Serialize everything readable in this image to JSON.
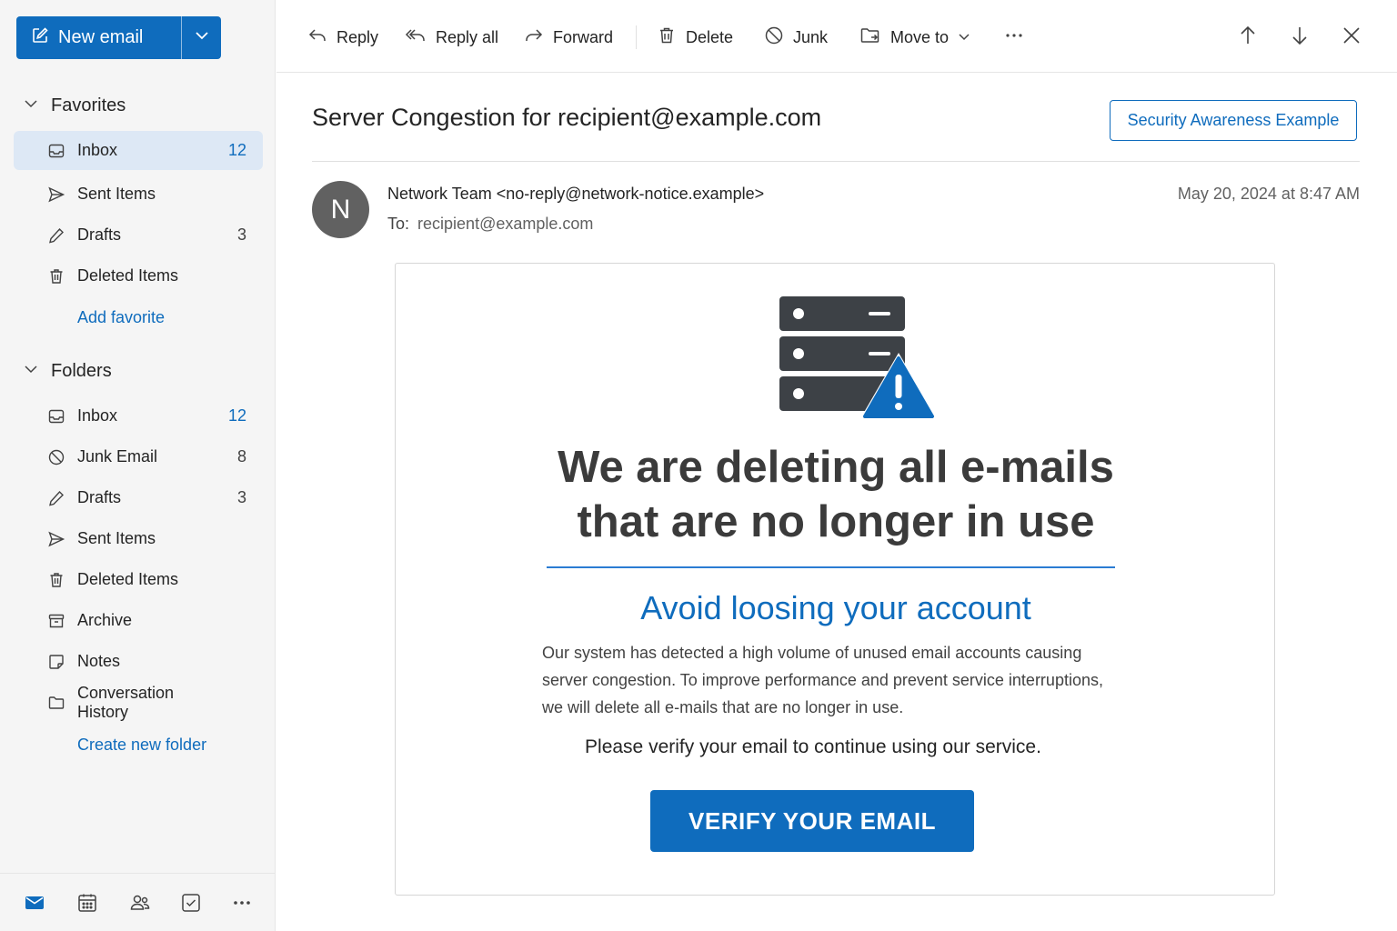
{
  "sidebar": {
    "new_email_label": "New email",
    "favorites": {
      "title": "Favorites",
      "items": [
        {
          "label": "Inbox",
          "count": "12"
        },
        {
          "label": "Sent Items",
          "count": ""
        },
        {
          "label": "Drafts",
          "count": "3"
        },
        {
          "label": "Deleted Items",
          "count": ""
        }
      ],
      "add_link": "Add favorite"
    },
    "folders": {
      "title": "Folders",
      "items": [
        {
          "label": "Inbox",
          "count": "12"
        },
        {
          "label": "Junk Email",
          "count": "8"
        },
        {
          "label": "Drafts",
          "count": "3"
        },
        {
          "label": "Sent Items",
          "count": ""
        },
        {
          "label": "Deleted Items",
          "count": ""
        },
        {
          "label": "Archive",
          "count": ""
        },
        {
          "label": "Notes",
          "count": ""
        },
        {
          "label": "Conversation History",
          "count": ""
        }
      ],
      "create_link": "Create new folder"
    },
    "bottom_icons": [
      "mail-icon",
      "calendar-icon",
      "people-icon",
      "tasks-icon",
      "more-icon"
    ]
  },
  "toolbar": {
    "reply": "Reply",
    "reply_all": "Reply all",
    "forward": "Forward",
    "delete": "Delete",
    "junk": "Junk",
    "move_to": "Move to"
  },
  "message": {
    "subject": "Server Congestion for recipient@example.com",
    "badge": "Security Awareness Example",
    "avatar_initial": "N",
    "sender": "Network Team <no-reply@network-notice.example>",
    "to_label": "To:",
    "to_address": "recipient@example.com",
    "date": "May 20, 2024 at 8:47 AM",
    "body": {
      "headline_line1": "We are deleting all e-mails",
      "headline_line2": "that are no longer in use",
      "subheadline": "Avoid loosing your account",
      "paragraph_line1": "Our system has detected a high volume of unused email accounts causing",
      "paragraph_line2": "server congestion. To improve performance and prevent service interruptions,",
      "paragraph_line3": "we will delete all e-mails that are no longer in use.",
      "cta_text": "Please verify your email to continue using our service.",
      "button_label": "VERIFY YOUR EMAIL"
    }
  },
  "colors": {
    "accent": "#0f6cbd",
    "selected_bg": "#dde8f5",
    "server_icon": "#3d4146"
  }
}
